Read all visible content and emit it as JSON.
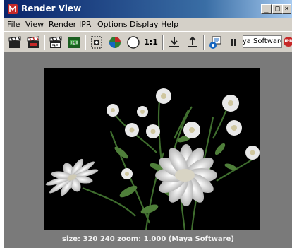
{
  "window": {
    "title": "Render View"
  },
  "titlebar_buttons": {
    "minimize": "_",
    "maximize": "□",
    "close": "×"
  },
  "menu": [
    "File",
    "View",
    "Render",
    "IPR",
    "Options",
    "Display",
    "Help"
  ],
  "toolbar": {
    "zoom_label": "1:1",
    "renderer": "Maya Software",
    "ipr_badge": "IPR",
    "tools": [
      "render-frame-icon",
      "redo-render-icon",
      "ipr-render-icon",
      "refresh-ipr-icon",
      "render-region-icon",
      "rgb-channels-icon",
      "alpha-channel-icon",
      "real-size-icon",
      "keep-image-icon",
      "remove-image-icon",
      "render-settings-icon",
      "pause-icon"
    ]
  },
  "status": {
    "text": "size:  320  240 zoom: 1.000  (Maya Software)"
  },
  "colors": {
    "title_start": "#0a246a",
    "title_end": "#a6caf0",
    "chrome": "#d4d0c8",
    "viewport": "#7a7a7a"
  }
}
